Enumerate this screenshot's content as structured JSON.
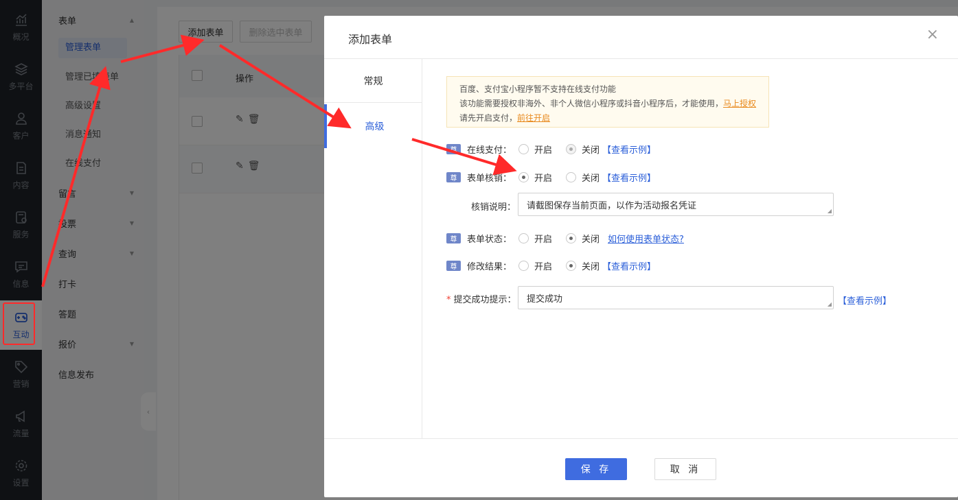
{
  "rail": {
    "items": [
      {
        "label": "概况",
        "icon": "chart-trend-icon"
      },
      {
        "label": "多平台",
        "icon": "layers-icon"
      },
      {
        "label": "客户",
        "icon": "user-icon"
      },
      {
        "label": "内容",
        "icon": "document-icon"
      },
      {
        "label": "服务",
        "icon": "service-icon"
      },
      {
        "label": "信息",
        "icon": "message-icon"
      },
      {
        "label": "互动",
        "icon": "gamepad-icon"
      },
      {
        "label": "营销",
        "icon": "tag-icon"
      },
      {
        "label": "流量",
        "icon": "megaphone-icon"
      },
      {
        "label": "设置",
        "icon": "gear-icon"
      }
    ],
    "active": "互动"
  },
  "submenu": {
    "groups": [
      {
        "label": "表单",
        "expanded": true
      },
      {
        "label": "留言"
      },
      {
        "label": "投票"
      },
      {
        "label": "查询"
      },
      {
        "label": "打卡"
      },
      {
        "label": "答题"
      },
      {
        "label": "报价"
      },
      {
        "label": "信息发布"
      }
    ],
    "form_items": [
      "管理表单",
      "管理已填表单",
      "高级设置",
      "消息通知",
      "在线支付"
    ],
    "active_item": "管理表单"
  },
  "toolbar": {
    "add_label": "添加表单",
    "delete_label": "删除选中表单"
  },
  "table": {
    "op_header": "操作"
  },
  "modal": {
    "title": "添加表单",
    "tabs": [
      "常规",
      "高级"
    ],
    "active_tab": "高级",
    "notice": {
      "line1": "百度、支付宝小程序暂不支持在线支付功能",
      "line2": "该功能需要授权非海外、非个人微信小程序或抖音小程序后，才能使用，",
      "line2_link": "马上授权",
      "line3": "请先开启支付，",
      "line3_link": "前往开启"
    },
    "vip_badge": "尊",
    "rows": {
      "online_pay": {
        "label": "在线支付：",
        "on": "开启",
        "off": "关闭",
        "selected": "关闭",
        "example": "【查看示例】"
      },
      "verify": {
        "label": "表单核销：",
        "on": "开启",
        "off": "关闭",
        "selected": "开启",
        "example": "【查看示例】"
      },
      "verify_note": {
        "label": "核销说明：",
        "value": "请截图保存当前页面，以作为活动报名凭证"
      },
      "status": {
        "label": "表单状态：",
        "on": "开启",
        "off": "关闭",
        "selected": "关闭",
        "help": "如何使用表单状态?"
      },
      "modify": {
        "label": "修改结果：",
        "on": "开启",
        "off": "关闭",
        "selected": "关闭",
        "example": "【查看示例】"
      },
      "success_tip": {
        "required_mark": "*",
        "label": "提交成功提示：",
        "value": "提交成功",
        "example": "【查看示例】"
      }
    },
    "save_label": "保 存",
    "cancel_label": "取 消"
  },
  "colors": {
    "rail_bg": "#1f2329",
    "accent": "#3f6ce0",
    "annotation_red": "#ff2a2a",
    "notice_link": "#e8891c"
  }
}
